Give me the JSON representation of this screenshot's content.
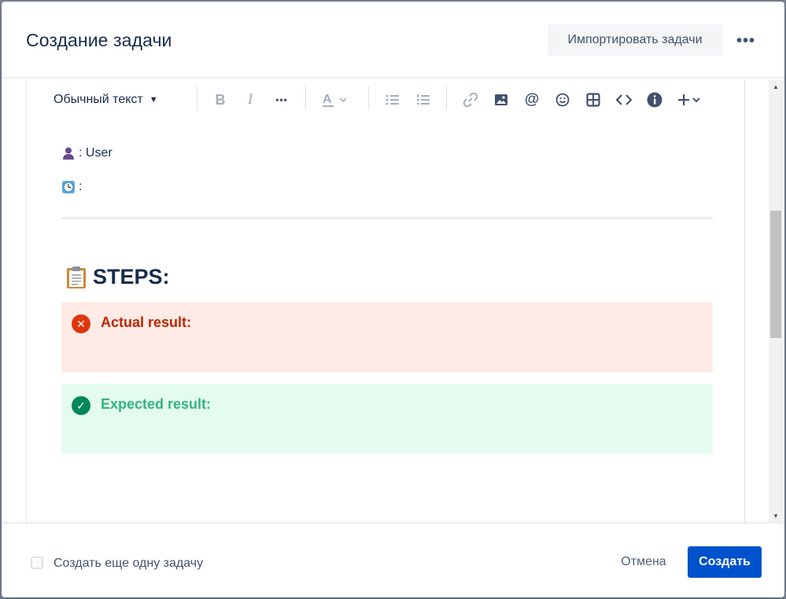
{
  "modal": {
    "title": "Создание задачи",
    "import_label": "Импортировать задачи",
    "more_label": "•••"
  },
  "toolbar": {
    "text_style": "Обычный текст",
    "buttons": [
      {
        "icon": "bold-icon",
        "glyph": "B"
      },
      {
        "icon": "italic-icon",
        "glyph": "I"
      },
      {
        "icon": "more-formatting-icon",
        "glyph": "•••"
      },
      {
        "icon": "text-color-icon",
        "glyph": "A"
      },
      {
        "icon": "bullet-list-icon"
      },
      {
        "icon": "numbered-list-icon"
      },
      {
        "icon": "link-icon"
      },
      {
        "icon": "image-icon"
      },
      {
        "icon": "mention-icon",
        "glyph": "@"
      },
      {
        "icon": "emoji-icon"
      },
      {
        "icon": "table-icon"
      },
      {
        "icon": "code-icon"
      },
      {
        "icon": "info-panel-icon"
      },
      {
        "icon": "insert-more-icon",
        "glyph": "+"
      }
    ]
  },
  "content": {
    "user_line": ": User",
    "clock_line": ":",
    "heading": "STEPS:",
    "actual_result": "Actual result:",
    "expected_result": "Expected result:"
  },
  "footer": {
    "create_another_label": "Создать еще одну задачу",
    "cancel_label": "Отмена",
    "create_label": "Создать"
  },
  "colors": {
    "primary": "#0052cc",
    "error_bg": "#ffebe6",
    "error_text": "#bf2600",
    "success_bg": "#e3fcef",
    "success_text": "#36b37e"
  }
}
